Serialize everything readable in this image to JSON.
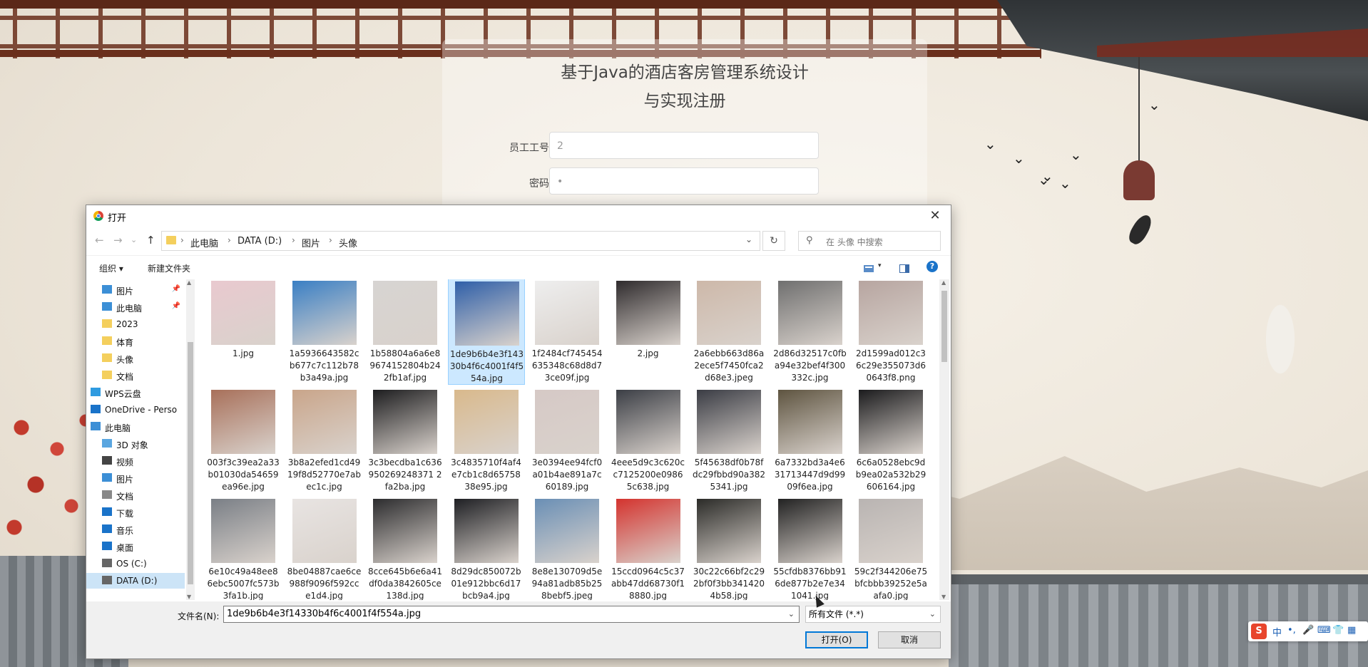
{
  "registration": {
    "title_line1": "基于Java的酒店客房管理系统设计",
    "title_line2": "与实现注册",
    "fields": [
      {
        "label": "员工工号",
        "value": "2"
      },
      {
        "label": "密码",
        "value": "•"
      }
    ]
  },
  "dialog": {
    "title": "打开",
    "close_glyph": "✕",
    "breadcrumb": [
      "此电脑",
      "DATA (D:)",
      "图片",
      "头像"
    ],
    "search_placeholder": "在 头像 中搜索",
    "toolbar": {
      "organize": "组织 ▾",
      "new_folder": "新建文件夹",
      "help": "?"
    },
    "nav": [
      {
        "label": "图片",
        "icon": "pictures-icon",
        "pinned": true
      },
      {
        "label": "此电脑",
        "icon": "computer-icon",
        "pinned": true
      },
      {
        "label": "2023",
        "icon": "folder-icon",
        "pinned": false
      },
      {
        "label": "体育",
        "icon": "folder-icon",
        "pinned": false
      },
      {
        "label": "头像",
        "icon": "folder-icon",
        "pinned": false
      },
      {
        "label": "文档",
        "icon": "folder-icon",
        "pinned": false
      },
      {
        "label": "WPS云盘",
        "icon": "cloud-icon",
        "pinned": false
      },
      {
        "label": "OneDrive - Perso",
        "icon": "onedrive-icon",
        "pinned": false
      },
      {
        "label": "此电脑",
        "icon": "computer-icon",
        "pinned": false
      },
      {
        "label": "3D 对象",
        "icon": "3d-objects-icon",
        "pinned": false
      },
      {
        "label": "视频",
        "icon": "video-icon",
        "pinned": false
      },
      {
        "label": "图片",
        "icon": "pictures-icon",
        "pinned": false
      },
      {
        "label": "文档",
        "icon": "documents-icon",
        "pinned": false
      },
      {
        "label": "下载",
        "icon": "download-icon",
        "pinned": false
      },
      {
        "label": "音乐",
        "icon": "music-icon",
        "pinned": false
      },
      {
        "label": "桌面",
        "icon": "desktop-icon",
        "pinned": false
      },
      {
        "label": "OS (C:)",
        "icon": "drive-icon",
        "pinned": false
      },
      {
        "label": "DATA (D:)",
        "icon": "drive-icon",
        "pinned": false
      }
    ],
    "files": [
      {
        "name": "1.jpg",
        "color": "#e9c9cf"
      },
      {
        "name": "1a5936643582cb677c7c112b78b3a49a.jpg",
        "color": "#3a7fc4"
      },
      {
        "name": "1b58804a6a6e89674152804b242fb1af.jpg",
        "color": "#d7d4d2"
      },
      {
        "name": "1de9b6b4e3f14330b4f6c4001f4f554a.jpg",
        "color": "#2f5fa8",
        "selected": true
      },
      {
        "name": "1f2484cf745454635348c68d8d73ce09f.jpg",
        "color": "#eeeeee"
      },
      {
        "name": "2.jpg",
        "color": "#2f2b2d"
      },
      {
        "name": "2a6ebb663d86a2ece5f7450fca2d68e3.jpeg",
        "color": "#cdb8a9"
      },
      {
        "name": "2d86d32517c0fba94e32bef4f300332c.jpg",
        "color": "#6f6f6f"
      },
      {
        "name": "2d1599ad012c36c29e355073d60643f8.png",
        "color": "#b7a5a0"
      },
      {
        "name": "003f3c39ea2a33b01030da54659ea96e.jpg",
        "color": "#a8705a"
      },
      {
        "name": "3b8a2efed1cd4919f8d52770e7abec1c.jpg",
        "color": "#c9a58a"
      },
      {
        "name": "3c3becdba1c636950269248371 2fa2ba.jpg",
        "color": "#1d1d1f"
      },
      {
        "name": "3c4835710f4af4e7cb1c8d6575838e95.jpg",
        "color": "#d9b98c"
      },
      {
        "name": "3e0394ee94fcf0a01b4ae891a7c60189.jpg",
        "color": "#d6c9c6"
      },
      {
        "name": "4eee5d9c3c620cc7125200e09865c638.jpg",
        "color": "#3b3e45"
      },
      {
        "name": "5f45638df0b78fdc29fbbd90a3825341.jpg",
        "color": "#3a3c44"
      },
      {
        "name": "6a7332bd3a4e631713447d9d9909f6ea.jpg",
        "color": "#5e5440"
      },
      {
        "name": "6c6a0528ebc9db9ea02a532b29606164.jpg",
        "color": "#1b1b1d"
      },
      {
        "name": "6e10c49a48ee86ebc5007fc573b3fa1b.jpg",
        "color": "#7a7f86"
      },
      {
        "name": "8be04887cae6ce988f9096f592cce1d4.jpg",
        "color": "#e8e4e2"
      },
      {
        "name": "8cce645b6e6a41df0da3842605ce138d.jpg",
        "color": "#2c2c2e"
      },
      {
        "name": "8d29dc850072b01e912bbc6d17bcb9a4.jpg",
        "color": "#1e1f23"
      },
      {
        "name": "8e8e130709d5e94a81adb85b258bebf5.jpeg",
        "color": "#6a8fb5"
      },
      {
        "name": "15ccd0964c5c37abb47dd68730f18880.jpg",
        "color": "#d4332e"
      },
      {
        "name": "30c22c66bf2c292bf0f3bb3414204b58.jpg",
        "color": "#2b2b28"
      },
      {
        "name": "55cfdb8376bb916de877b2e7e341041.jpg",
        "color": "#222222"
      },
      {
        "name": "59c2f344206e75bfcbbb39252e5aafa0.jpg",
        "color": "#b9b4b2"
      }
    ],
    "filename_label": "文件名(N):",
    "filename_value": "1de9b6b4e3f14330b4f6c4001f4f554a.jpg",
    "filetype_value": "所有文件 (*.*)",
    "open_label": "打开(O)",
    "cancel_label": "取消"
  },
  "ime": {
    "logo": "S",
    "items": [
      "中",
      "•,",
      "🎤",
      "⌨",
      "👕",
      "▦"
    ]
  }
}
